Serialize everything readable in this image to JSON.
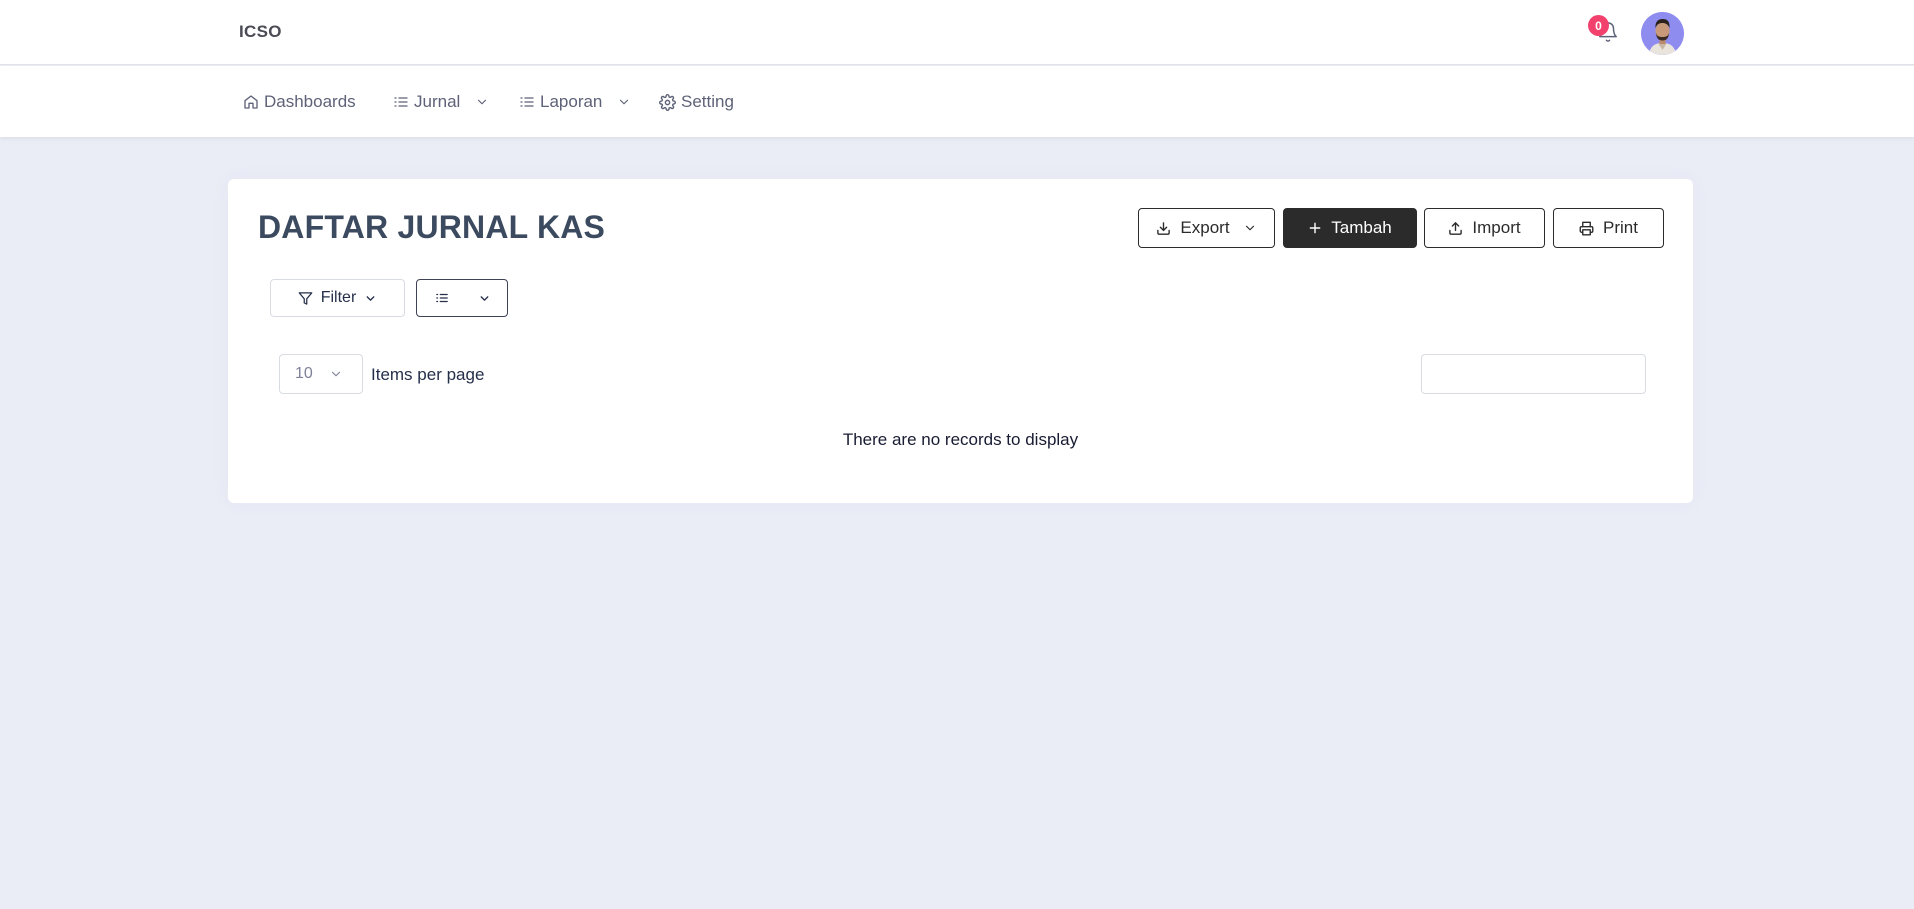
{
  "app": {
    "brand": "ICSO"
  },
  "notifications": {
    "count": "0"
  },
  "nav": {
    "dashboards": "Dashboards",
    "jurnal": "Jurnal",
    "laporan": "Laporan",
    "setting": "Setting"
  },
  "page": {
    "title": "DAFTAR JURNAL KAS"
  },
  "actions": {
    "export": "Export",
    "tambah": "Tambah",
    "import": "Import",
    "print": "Print"
  },
  "toolbar": {
    "filter": "Filter"
  },
  "table": {
    "per_page_value": "10",
    "per_page_label": "Items per page",
    "search_placeholder": "",
    "empty_message": "There are no records to display"
  },
  "colors": {
    "background": "#eaedf6",
    "primary_button": "#2b2b2b",
    "badge": "#f1416c",
    "avatar_bg": "#8f8cf0"
  }
}
